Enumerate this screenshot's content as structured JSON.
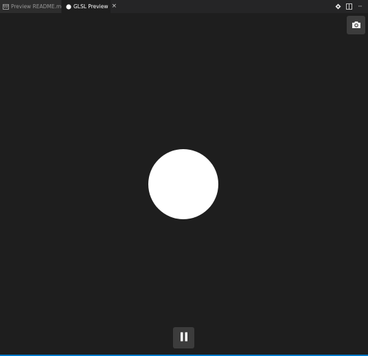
{
  "tabs": [
    {
      "label": "Preview README.md",
      "icon": "preview-icon",
      "active": false
    },
    {
      "label": "GLSL Preview",
      "icon": "circle-icon",
      "active": true,
      "close": "×"
    }
  ],
  "actions": [
    "open-source-icon",
    "split-editor-icon",
    "more-icon"
  ],
  "more_label": "···",
  "controls": {
    "screenshot_icon": "camera-icon",
    "pause_icon": "pause-icon"
  },
  "colors": {
    "background": "#1e1e1e",
    "tabbar": "#252526",
    "button": "#3c3c3c",
    "shape": "#ffffff",
    "accent": "#007acc"
  }
}
